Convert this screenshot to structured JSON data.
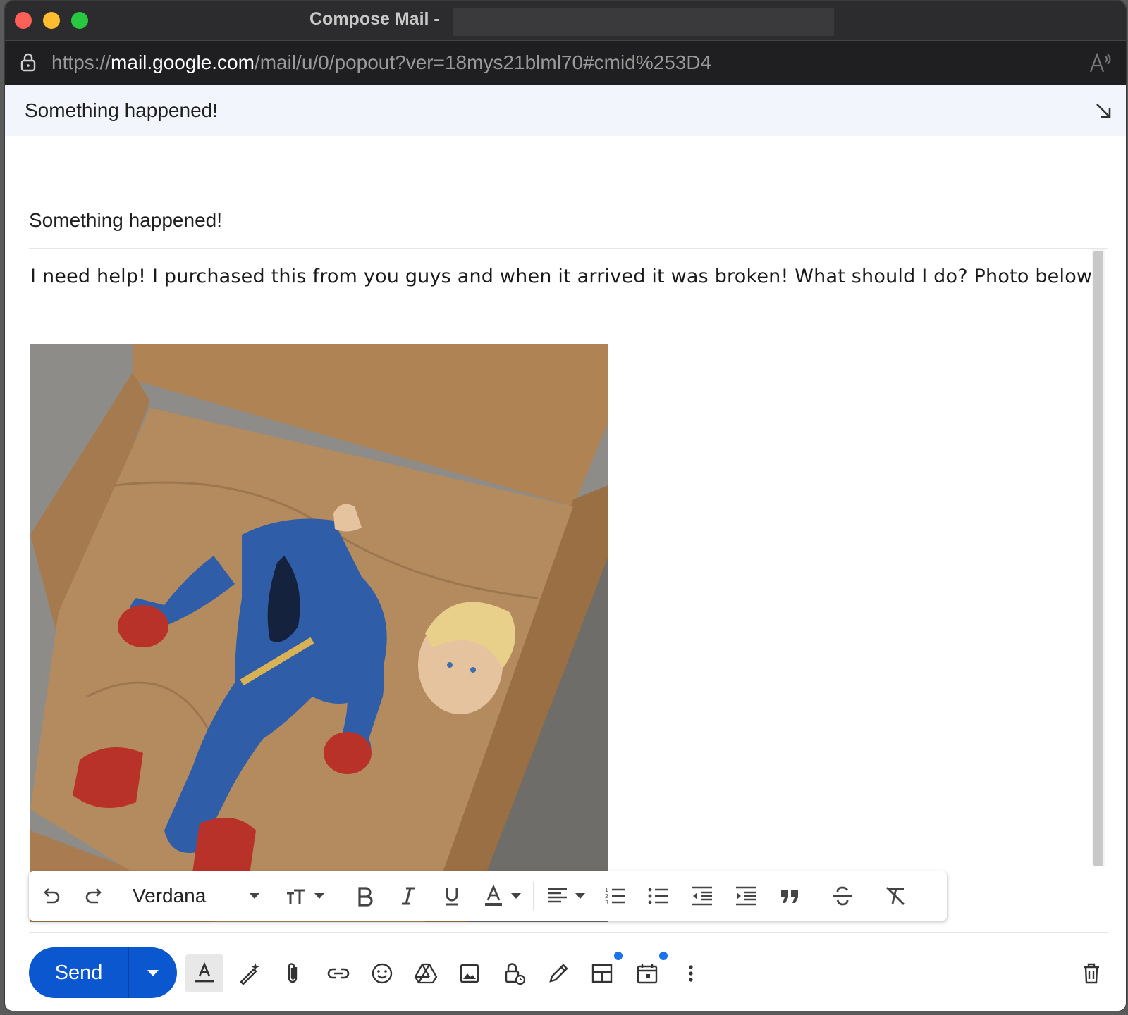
{
  "window": {
    "title": "Compose Mail -",
    "url_prefix": "https://",
    "url_domain": "mail.google.com",
    "url_path": "/mail/u/0/popout?ver=18mys21blml70#cmid%253D4"
  },
  "compose": {
    "header_title": "Something happened!",
    "subject": "Something happened!",
    "body_text": "I need help! I purchased this from you guys and when it arrived it was broken! What should I do? Photo below..."
  },
  "format_toolbar": {
    "font_name": "Verdana",
    "icons": [
      "undo-icon",
      "redo-icon",
      "font-size-icon",
      "bold-icon",
      "italic-icon",
      "underline-icon",
      "text-color-icon",
      "align-icon",
      "numbered-list-icon",
      "bulleted-list-icon",
      "indent-less-icon",
      "indent-more-icon",
      "quote-icon",
      "strikethrough-icon",
      "remove-formatting-icon"
    ]
  },
  "bottom_toolbar": {
    "send_label": "Send",
    "icons": [
      "formatting-options-icon",
      "help-me-write-icon",
      "attach-icon",
      "link-icon",
      "emoji-icon",
      "drive-icon",
      "photo-icon",
      "confidential-mode-icon",
      "signature-icon",
      "layouts-icon",
      "schedule-icon",
      "more-options-icon",
      "delete-icon"
    ]
  },
  "colors": {
    "send_button": "#0b57d0",
    "header_bg": "#f2f6fc",
    "notification_dot": "#1a73e8"
  }
}
